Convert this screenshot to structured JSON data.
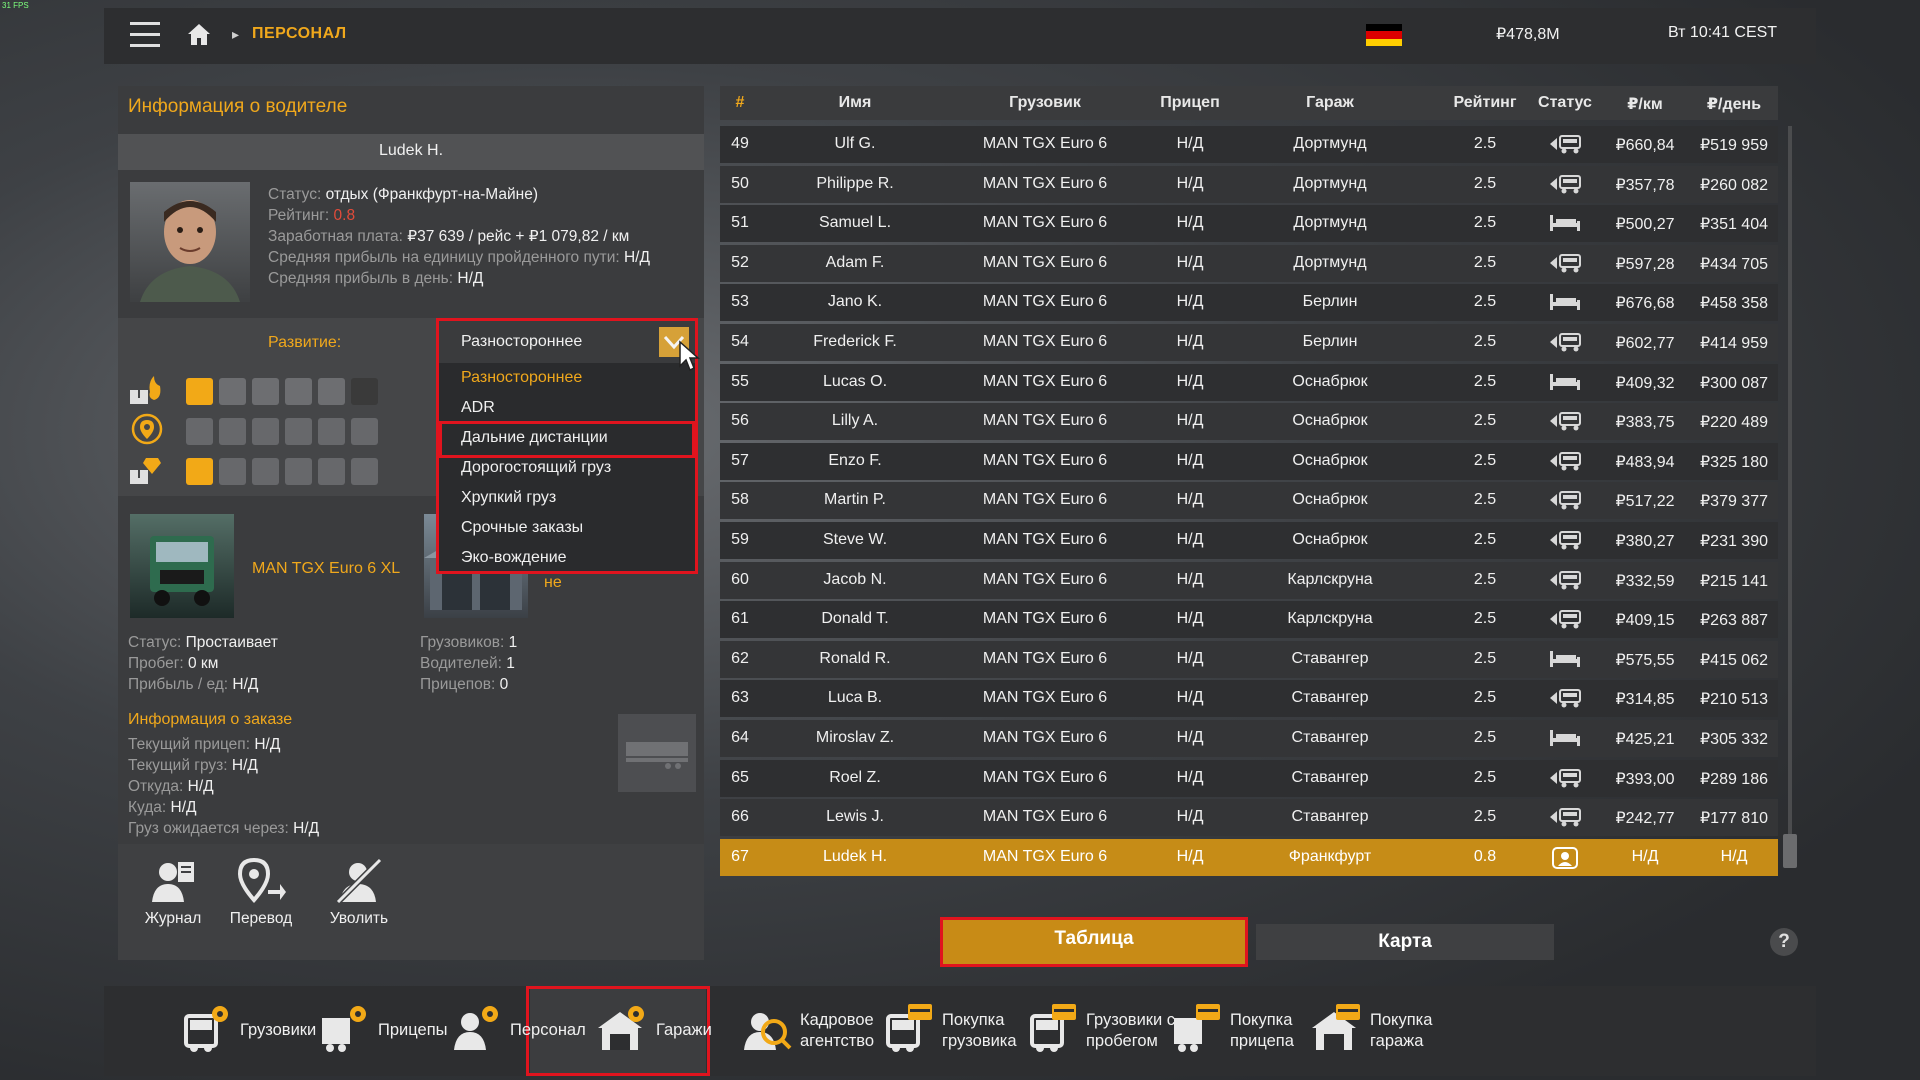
{
  "fps": "31 FPS",
  "topbar": {
    "breadcrumb": "ПЕРСОНАЛ",
    "money": "₽478,8M",
    "time": "Вт 10:41 CEST",
    "colors": {
      "accent": "#f0a81c",
      "flag": [
        "#000000",
        "#dd0000",
        "#ffce00"
      ]
    }
  },
  "driver": {
    "panel_title": "Информация о водителе",
    "name": "Ludek H.",
    "status_label": "Статус: ",
    "status_value": "отдых (Франкфурт-на-Майне)",
    "rating_label": "Рейтинг: ",
    "rating_value": "0.8",
    "salary_label": "Заработная плата: ",
    "salary_value": "₽37 639 / рейс + ₽1 079,82 / км",
    "avg_profit_km_label": "Средняя прибыль на единицу пройденного пути: ",
    "avg_profit_km_value": "Н/Д",
    "avg_profit_day_label": "Средняя прибыль в день: ",
    "avg_profit_day_value": "Н/Д",
    "development_label": "Развитие:",
    "development_icons": [
      "fire-icon",
      "adr-hazard-icon",
      "location-pin-icon",
      "cargo-icon"
    ],
    "truck": {
      "name": "MAN TGX Euro 6 XL",
      "status_label": "Статус: ",
      "status_value": "Простаивает",
      "mileage_label": "Пробег: ",
      "mileage_value": "0 км",
      "profit_label": "Прибыль / ед: ",
      "profit_value": "Н/Д"
    },
    "garage": {
      "name_tail": "не",
      "trucks_label": "Грузовиков: ",
      "trucks_value": "1",
      "drivers_label": "Водителей: ",
      "drivers_value": "1",
      "trailers_label": "Прицепов: ",
      "trailers_value": "0"
    },
    "order": {
      "title": "Информация о заказе",
      "trailer_label": "Текущий прицеп: ",
      "trailer_value": "Н/Д",
      "cargo_label": "Текущий груз: ",
      "cargo_value": "Н/Д",
      "from_label": "Откуда: ",
      "from_value": "Н/Д",
      "to_label": "Куда: ",
      "to_value": "Н/Д",
      "expected_label": "Груз ожидается через: ",
      "expected_value": "Н/Д"
    },
    "actions": {
      "journal": "Журнал",
      "transfer": "Перевод",
      "fire": "Уволить"
    }
  },
  "dropdown": {
    "current": "Разностороннее",
    "options": [
      "Разностороннее",
      "ADR",
      "Дальние дистанции",
      "Дорогостоящий груз",
      "Хрупкий груз",
      "Срочные заказы",
      "Эко-вождение"
    ],
    "highlighted": "Дальние дистанции"
  },
  "table": {
    "headers": [
      "#",
      "Имя",
      "Грузовик",
      "Прицеп",
      "Гараж",
      "Рейтинг",
      "Статус",
      "₽/км",
      "₽/день"
    ],
    "rows": [
      [
        "49",
        "Ulf G.",
        "MAN TGX Euro 6",
        "Н/Д",
        "Дортмунд",
        "2.5",
        "driving-icon",
        "₽660,84",
        "₽519 959"
      ],
      [
        "50",
        "Philippe R.",
        "MAN TGX Euro 6",
        "Н/Д",
        "Дортмунд",
        "2.5",
        "driving-icon",
        "₽357,78",
        "₽260 082"
      ],
      [
        "51",
        "Samuel L.",
        "MAN TGX Euro 6",
        "Н/Д",
        "Дортмунд",
        "2.5",
        "rest-icon",
        "₽500,27",
        "₽351 404"
      ],
      [
        "52",
        "Adam F.",
        "MAN TGX Euro 6",
        "Н/Д",
        "Дортмунд",
        "2.5",
        "driving-icon",
        "₽597,28",
        "₽434 705"
      ],
      [
        "53",
        "Jano K.",
        "MAN TGX Euro 6",
        "Н/Д",
        "Берлин",
        "2.5",
        "rest-icon",
        "₽676,68",
        "₽458 358"
      ],
      [
        "54",
        "Frederick F.",
        "MAN TGX Euro 6",
        "Н/Д",
        "Берлин",
        "2.5",
        "driving-icon",
        "₽602,77",
        "₽414 959"
      ],
      [
        "55",
        "Lucas O.",
        "MAN TGX Euro 6",
        "Н/Д",
        "Оснабрюк",
        "2.5",
        "rest-icon",
        "₽409,32",
        "₽300 087"
      ],
      [
        "56",
        "Lilly A.",
        "MAN TGX Euro 6",
        "Н/Д",
        "Оснабрюк",
        "2.5",
        "driving-icon",
        "₽383,75",
        "₽220 489"
      ],
      [
        "57",
        "Enzo F.",
        "MAN TGX Euro 6",
        "Н/Д",
        "Оснабрюк",
        "2.5",
        "driving-icon",
        "₽483,94",
        "₽325 180"
      ],
      [
        "58",
        "Martin P.",
        "MAN TGX Euro 6",
        "Н/Д",
        "Оснабрюк",
        "2.5",
        "driving-icon",
        "₽517,22",
        "₽379 377"
      ],
      [
        "59",
        "Steve W.",
        "MAN TGX Euro 6",
        "Н/Д",
        "Оснабрюк",
        "2.5",
        "driving-icon",
        "₽380,27",
        "₽231 390"
      ],
      [
        "60",
        "Jacob N.",
        "MAN TGX Euro 6",
        "Н/Д",
        "Карлскруна",
        "2.5",
        "driving-icon",
        "₽332,59",
        "₽215 141"
      ],
      [
        "61",
        "Donald T.",
        "MAN TGX Euro 6",
        "Н/Д",
        "Карлскруна",
        "2.5",
        "driving-icon",
        "₽409,15",
        "₽263 887"
      ],
      [
        "62",
        "Ronald R.",
        "MAN TGX Euro 6",
        "Н/Д",
        "Ставангер",
        "2.5",
        "rest-icon",
        "₽575,55",
        "₽415 062"
      ],
      [
        "63",
        "Luca B.",
        "MAN TGX Euro 6",
        "Н/Д",
        "Ставангер",
        "2.5",
        "driving-icon",
        "₽314,85",
        "₽210 513"
      ],
      [
        "64",
        "Miroslav Z.",
        "MAN TGX Euro 6",
        "Н/Д",
        "Ставангер",
        "2.5",
        "rest-icon",
        "₽425,21",
        "₽305 332"
      ],
      [
        "65",
        "Roel Z.",
        "MAN TGX Euro 6",
        "Н/Д",
        "Ставангер",
        "2.5",
        "driving-icon",
        "₽393,00",
        "₽289 186"
      ],
      [
        "66",
        "Lewis J.",
        "MAN TGX Euro 6",
        "Н/Д",
        "Ставангер",
        "2.5",
        "driving-icon",
        "₽242,77",
        "₽177 810"
      ],
      [
        "67",
        "Ludek H.",
        "MAN TGX Euro 6",
        "Н/Д",
        "Франкфурт",
        "0.8",
        "idle-driver-icon",
        "Н/Д",
        "Н/Д"
      ]
    ],
    "selected_index": 18
  },
  "view": {
    "table_label": "Таблица",
    "map_label": "Карта",
    "help": "?"
  },
  "bottom_nav": [
    {
      "label": "Грузовики",
      "icon": "truck-gear-icon"
    },
    {
      "label": "Прицепы",
      "icon": "trailer-gear-icon"
    },
    {
      "label": "Персонал",
      "icon": "staff-gear-icon",
      "active": true
    },
    {
      "label": "Гаражи",
      "icon": "garage-gear-icon"
    },
    {
      "label": "Кадровое\nагентство",
      "icon": "recruitment-agency-icon"
    },
    {
      "label": "Покупка\nгрузовика",
      "icon": "buy-truck-icon"
    },
    {
      "label": "Грузовики с\nпробегом",
      "icon": "used-truck-icon"
    },
    {
      "label": "Покупка\nприцепа",
      "icon": "buy-trailer-icon"
    },
    {
      "label": "Покупка\nгаража",
      "icon": "buy-garage-icon"
    }
  ]
}
